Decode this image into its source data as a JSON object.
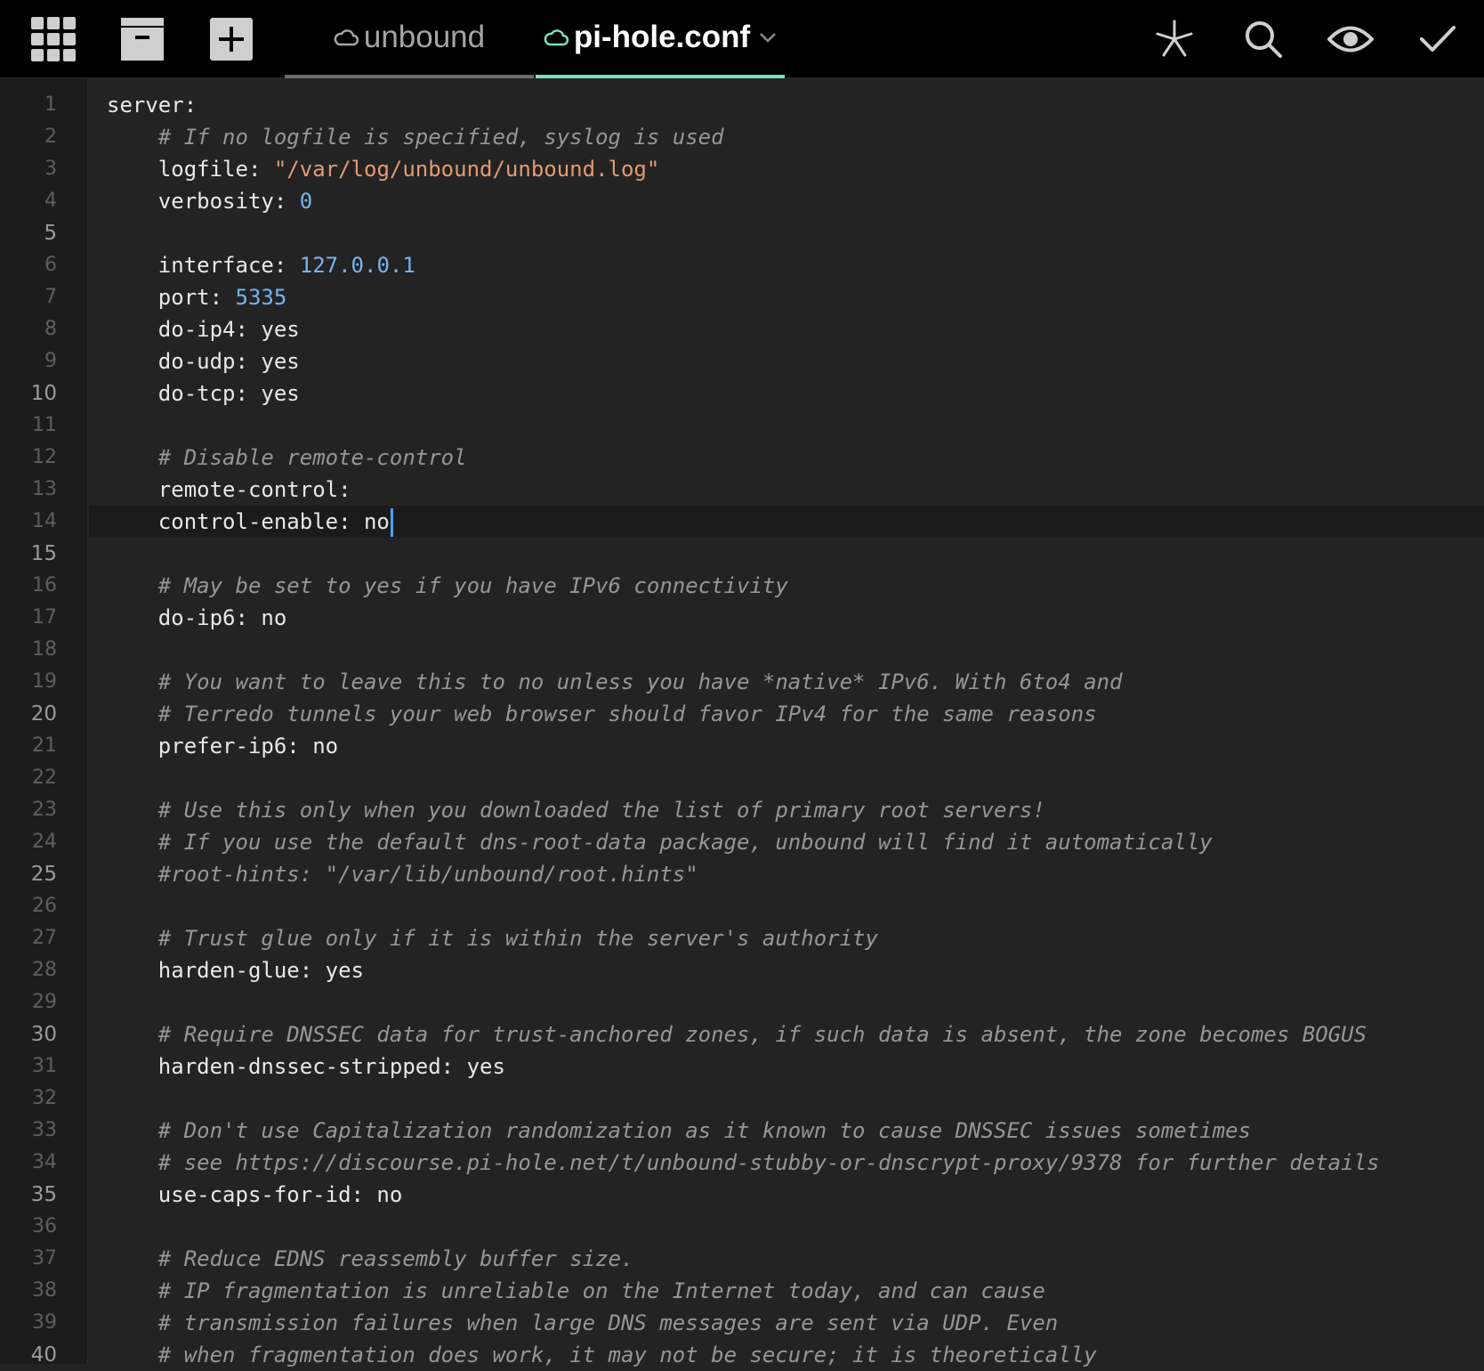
{
  "toolbar": {
    "tabs": [
      {
        "label": "unbound",
        "active": false
      },
      {
        "label": "pi-hole.conf",
        "active": true
      }
    ],
    "icons_left": [
      "grid-icon",
      "archive-icon",
      "plus-icon"
    ],
    "icons_right": [
      "asterisk-icon",
      "search-icon",
      "eye-icon",
      "check-icon"
    ],
    "accent_color": "#7be0c0"
  },
  "editor": {
    "cursor_line": 14,
    "highlight_color": "#4da2ff",
    "lines": [
      {
        "n": 1,
        "spans": [
          {
            "t": "server:"
          }
        ]
      },
      {
        "n": 2,
        "spans": [
          {
            "t": "    "
          },
          {
            "t": "# If no logfile is specified, syslog is used",
            "k": "c"
          }
        ]
      },
      {
        "n": 3,
        "spans": [
          {
            "t": "    logfile: "
          },
          {
            "t": "\"/var/log/unbound/unbound.log\"",
            "k": "s"
          }
        ]
      },
      {
        "n": 4,
        "spans": [
          {
            "t": "    verbosity: "
          },
          {
            "t": "0",
            "k": "n"
          }
        ]
      },
      {
        "n": 5,
        "spans": []
      },
      {
        "n": 6,
        "spans": [
          {
            "t": "    interface: "
          },
          {
            "t": "127.0.0.1",
            "k": "n"
          }
        ]
      },
      {
        "n": 7,
        "spans": [
          {
            "t": "    port: "
          },
          {
            "t": "5335",
            "k": "n"
          }
        ]
      },
      {
        "n": 8,
        "spans": [
          {
            "t": "    do-ip4: yes"
          }
        ]
      },
      {
        "n": 9,
        "spans": [
          {
            "t": "    do-udp: yes"
          }
        ]
      },
      {
        "n": 10,
        "spans": [
          {
            "t": "    do-tcp: yes"
          }
        ]
      },
      {
        "n": 11,
        "spans": []
      },
      {
        "n": 12,
        "spans": [
          {
            "t": "    "
          },
          {
            "t": "# Disable remote-control",
            "k": "c"
          }
        ]
      },
      {
        "n": 13,
        "spans": [
          {
            "t": "    remote-control:"
          }
        ]
      },
      {
        "n": 14,
        "spans": [
          {
            "t": "    control-enable: no"
          }
        ]
      },
      {
        "n": 15,
        "spans": []
      },
      {
        "n": 16,
        "spans": [
          {
            "t": "    "
          },
          {
            "t": "# May be set to yes if you have IPv6 connectivity",
            "k": "c"
          }
        ]
      },
      {
        "n": 17,
        "spans": [
          {
            "t": "    do-ip6: no"
          }
        ]
      },
      {
        "n": 18,
        "spans": []
      },
      {
        "n": 19,
        "spans": [
          {
            "t": "    "
          },
          {
            "t": "# You want to leave this to no unless you have *native* IPv6. With 6to4 and",
            "k": "c"
          }
        ]
      },
      {
        "n": 20,
        "spans": [
          {
            "t": "    "
          },
          {
            "t": "# Terredo tunnels your web browser should favor IPv4 for the same reasons",
            "k": "c"
          }
        ]
      },
      {
        "n": 21,
        "spans": [
          {
            "t": "    prefer-ip6: no"
          }
        ]
      },
      {
        "n": 22,
        "spans": []
      },
      {
        "n": 23,
        "spans": [
          {
            "t": "    "
          },
          {
            "t": "# Use this only when you downloaded the list of primary root servers!",
            "k": "c"
          }
        ]
      },
      {
        "n": 24,
        "spans": [
          {
            "t": "    "
          },
          {
            "t": "# If you use the default dns-root-data package, unbound will find it automatically",
            "k": "c"
          }
        ]
      },
      {
        "n": 25,
        "spans": [
          {
            "t": "    "
          },
          {
            "t": "#root-hints: \"/var/lib/unbound/root.hints\"",
            "k": "c"
          }
        ]
      },
      {
        "n": 26,
        "spans": []
      },
      {
        "n": 27,
        "spans": [
          {
            "t": "    "
          },
          {
            "t": "# Trust glue only if it is within the server's authority",
            "k": "c"
          }
        ]
      },
      {
        "n": 28,
        "spans": [
          {
            "t": "    harden-glue: yes"
          }
        ]
      },
      {
        "n": 29,
        "spans": []
      },
      {
        "n": 30,
        "spans": [
          {
            "t": "    "
          },
          {
            "t": "# Require DNSSEC data for trust-anchored zones, if such data is absent, the zone becomes BOGUS",
            "k": "c"
          }
        ]
      },
      {
        "n": 31,
        "spans": [
          {
            "t": "    harden-dnssec-stripped: yes"
          }
        ]
      },
      {
        "n": 32,
        "spans": []
      },
      {
        "n": 33,
        "spans": [
          {
            "t": "    "
          },
          {
            "t": "# Don't use Capitalization randomization as it known to cause DNSSEC issues sometimes",
            "k": "c"
          }
        ]
      },
      {
        "n": 34,
        "spans": [
          {
            "t": "    "
          },
          {
            "t": "# see https://discourse.pi-hole.net/t/unbound-stubby-or-dnscrypt-proxy/9378 for further details",
            "k": "c"
          }
        ]
      },
      {
        "n": 35,
        "spans": [
          {
            "t": "    use-caps-for-id: no"
          }
        ]
      },
      {
        "n": 36,
        "spans": []
      },
      {
        "n": 37,
        "spans": [
          {
            "t": "    "
          },
          {
            "t": "# Reduce EDNS reassembly buffer size.",
            "k": "c"
          }
        ]
      },
      {
        "n": 38,
        "spans": [
          {
            "t": "    "
          },
          {
            "t": "# IP fragmentation is unreliable on the Internet today, and can cause",
            "k": "c"
          }
        ]
      },
      {
        "n": 39,
        "spans": [
          {
            "t": "    "
          },
          {
            "t": "# transmission failures when large DNS messages are sent via UDP. Even",
            "k": "c"
          }
        ]
      },
      {
        "n": 40,
        "spans": [
          {
            "t": "    "
          },
          {
            "t": "# when fragmentation does work, it may not be secure; it is theoretically",
            "k": "c"
          }
        ]
      }
    ]
  }
}
